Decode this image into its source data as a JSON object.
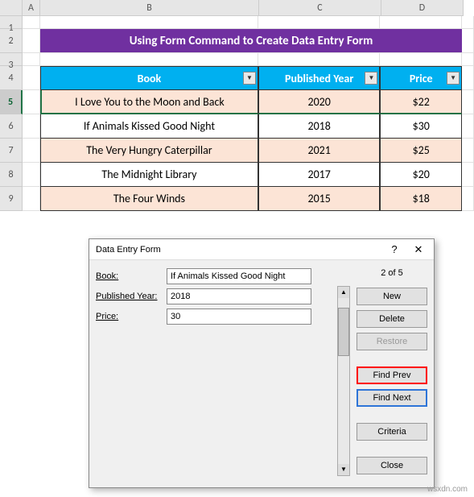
{
  "columns": [
    "A",
    "B",
    "C",
    "D"
  ],
  "rows": [
    "1",
    "2",
    "3",
    "4",
    "5",
    "6",
    "7",
    "8",
    "9"
  ],
  "selected_row": "5",
  "title": "Using Form Command to Create Data Entry Form",
  "table": {
    "headers": [
      "Book",
      "Published Year",
      "Price"
    ],
    "rows": [
      {
        "book": "I Love You to the Moon and Back",
        "year": "2020",
        "price": "$22"
      },
      {
        "book": "If Animals Kissed Good Night",
        "year": "2018",
        "price": "$30"
      },
      {
        "book": "The Very Hungry Caterpillar",
        "year": "2021",
        "price": "$25"
      },
      {
        "book": "The Midnight Library",
        "year": "2017",
        "price": "$20"
      },
      {
        "book": "The Four Winds",
        "year": "2015",
        "price": "$18"
      }
    ]
  },
  "dialog": {
    "title": "Data Entry Form",
    "record_count": "2 of 5",
    "fields": {
      "book_label": "Book:",
      "book_value": "If Animals Kissed Good Night",
      "year_label": "Published Year:",
      "year_value": "2018",
      "price_label": "Price:",
      "price_value": "30"
    },
    "buttons": {
      "new": "New",
      "delete": "Delete",
      "restore": "Restore",
      "find_prev": "Find Prev",
      "find_next": "Find Next",
      "criteria": "Criteria",
      "close": "Close"
    },
    "help": "?",
    "close_icon": "✕"
  },
  "watermark": "wsxdn.com"
}
